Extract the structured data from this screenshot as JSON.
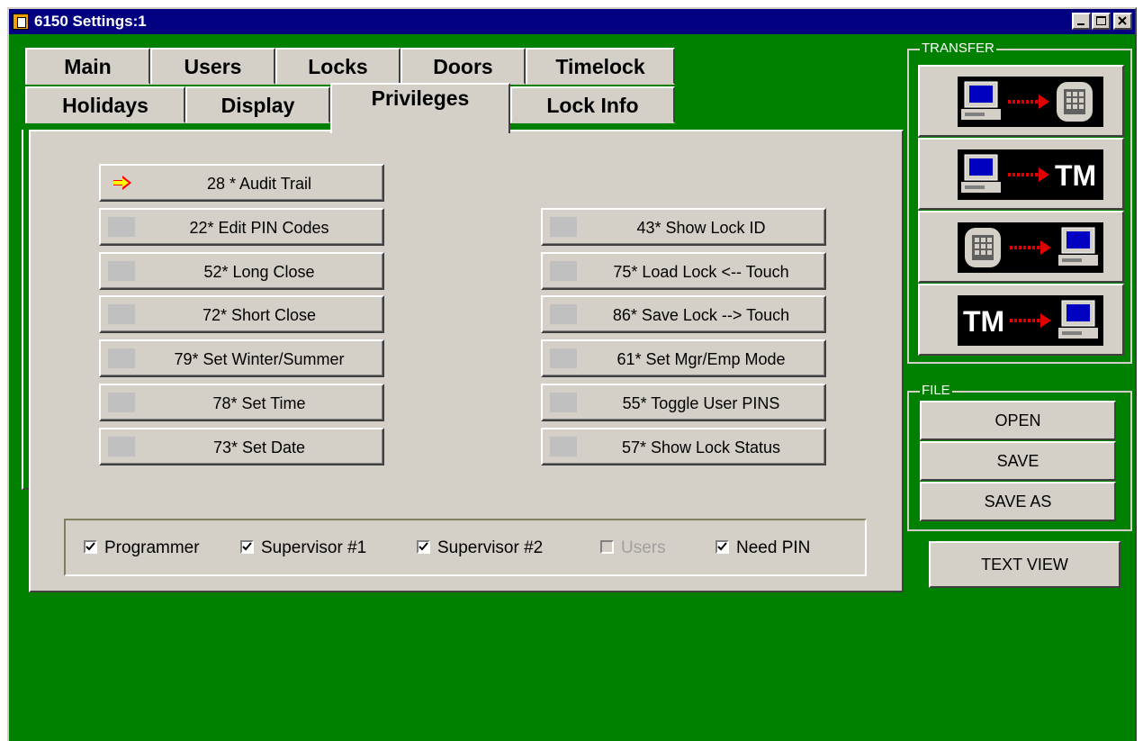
{
  "window": {
    "title": "6150 Settings:1",
    "controls": [
      "minimize",
      "maximize",
      "close"
    ]
  },
  "tabs": {
    "row1": [
      {
        "label": "Main"
      },
      {
        "label": "Users"
      },
      {
        "label": "Locks"
      },
      {
        "label": "Doors"
      },
      {
        "label": "Timelock"
      }
    ],
    "row2": [
      {
        "label": "Holidays"
      },
      {
        "label": "Display"
      },
      {
        "label": "Privileges",
        "active": true
      },
      {
        "label": "Lock Info"
      }
    ]
  },
  "privileges": {
    "left": [
      {
        "label": "28 * Audit Trail",
        "active": true
      },
      {
        "label": "22* Edit PIN Codes"
      },
      {
        "label": "52*  Long Close"
      },
      {
        "label": "72*  Short Close"
      },
      {
        "label": "79* Set Winter/Summer"
      },
      {
        "label": "78* Set Time"
      },
      {
        "label": "73* Set Date"
      }
    ],
    "right": [
      {
        "label": "43* Show Lock ID"
      },
      {
        "label": "75* Load Lock <-- Touch"
      },
      {
        "label": "86* Save Lock --> Touch"
      },
      {
        "label": "61* Set Mgr/Emp Mode"
      },
      {
        "label": "55* Toggle User PINS"
      },
      {
        "label": "57* Show Lock Status"
      }
    ]
  },
  "checkboxes": [
    {
      "label": "Programmer",
      "checked": true,
      "enabled": true
    },
    {
      "label": "Supervisor #1",
      "checked": true,
      "enabled": true
    },
    {
      "label": "Supervisor #2",
      "checked": true,
      "enabled": true
    },
    {
      "label": "Users",
      "checked": false,
      "enabled": false
    },
    {
      "label": "Need PIN",
      "checked": true,
      "enabled": true
    }
  ],
  "transfer": {
    "title": "TRANSFER",
    "buttons": [
      {
        "icon": "computer-to-lock-icon"
      },
      {
        "icon": "computer-to-touchmemory-icon",
        "text": "TM"
      },
      {
        "icon": "lock-to-computer-icon"
      },
      {
        "icon": "touchmemory-to-computer-icon",
        "text": "TM"
      }
    ]
  },
  "file": {
    "title": "FILE",
    "open": "OPEN",
    "save": "SAVE",
    "save_as": "SAVE AS"
  },
  "text_view": "TEXT VIEW",
  "colors": {
    "background": "#008000",
    "face": "#d4d0c8",
    "titlebar": "#000080",
    "arrow": "#e00000"
  }
}
